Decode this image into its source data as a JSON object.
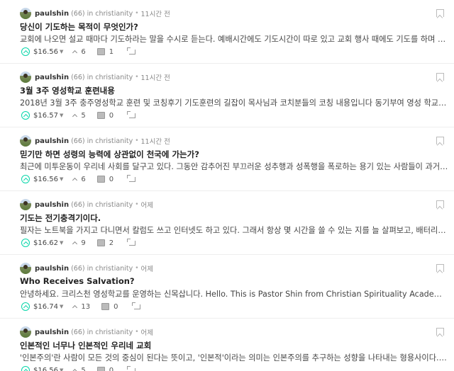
{
  "posts": [
    {
      "author": "paulshin",
      "reputation": "(66)",
      "in_text": "in",
      "category": "christianity",
      "separator": "•",
      "time": "11시간 전",
      "title": "당신이 기도하는 목적이 무엇인가?",
      "excerpt": "교회에 나오면 설교 때마다 기도하라는 말을 수시로 듣는다. 예배시간에도 기도시간이 따로 있고 교회 행사 때에도 기도를 하며 기도…",
      "payout": "$16.56",
      "votes": "6",
      "comments": "1"
    },
    {
      "author": "paulshin",
      "reputation": "(66)",
      "in_text": "in",
      "category": "christianity",
      "separator": "•",
      "time": "11시간 전",
      "title": "3월 3주 영성학교 훈련내용",
      "excerpt": "2018년 3월 3주 충주영성학교 훈련 및 코칭후기 기도훈련의 길잡이 목사님과 코치분들의 코칭 내용입니다 동기부여 영성 학교는 기…",
      "payout": "$16.57",
      "votes": "5",
      "comments": "0"
    },
    {
      "author": "paulshin",
      "reputation": "(66)",
      "in_text": "in",
      "category": "christianity",
      "separator": "•",
      "time": "11시간 전",
      "title": "믿기만 하면 성령의 능력에 상관없이 천국에 가는가?",
      "excerpt": "최근에 미투운동이 우리네 사회를 달구고 있다. 그동안 감추어진 부끄러운 성추행과 성폭행을 폭로하는 용기 있는 사람들이 과거의 …",
      "payout": "$16.56",
      "votes": "6",
      "comments": "0"
    },
    {
      "author": "paulshin",
      "reputation": "(66)",
      "in_text": "in",
      "category": "christianity",
      "separator": "•",
      "time": "어제",
      "title": "기도는 전기충격기이다.",
      "excerpt": "필자는 노트북을 가지고 다니면서 칼럼도 쓰고 인터넷도 하고 있다. 그래서 항상 몇 시간을 쓸 수 있는 지를 늘 살펴보고, 배터리가 소…",
      "payout": "$16.62",
      "votes": "9",
      "comments": "2"
    },
    {
      "author": "paulshin",
      "reputation": "(66)",
      "in_text": "in",
      "category": "christianity",
      "separator": "•",
      "time": "어제",
      "title": "Who Receives Salvation?",
      "excerpt": "안녕하세요. 크리스천 영성학교를 운영하는 신목삽니다. Hello. This is Pastor Shin from Christian Spirituality Academy. 오늘은 '구원…",
      "payout": "$16.74",
      "votes": "13",
      "comments": "0"
    },
    {
      "author": "paulshin",
      "reputation": "(66)",
      "in_text": "in",
      "category": "christianity",
      "separator": "•",
      "time": "어제",
      "title": "인본적인 너무나 인본적인 우리네 교회",
      "excerpt": "'인본주의'란 사람이 모든 것의 중심이 된다는 뜻이고, '인본적'이라는 의미는 인본주의를 추구하는 성향을 나타내는 형용사이다. 중세…",
      "payout": "$16.56",
      "votes": "5",
      "comments": "0"
    }
  ],
  "icons": {
    "upvote": "upvote-circle-icon",
    "voters": "chevron-up-icon",
    "comments": "comment-icon",
    "resteem": "resteem-icon",
    "bookmark": "bookmark-icon"
  },
  "colors": {
    "upvote_accent": "#06d6a9"
  }
}
